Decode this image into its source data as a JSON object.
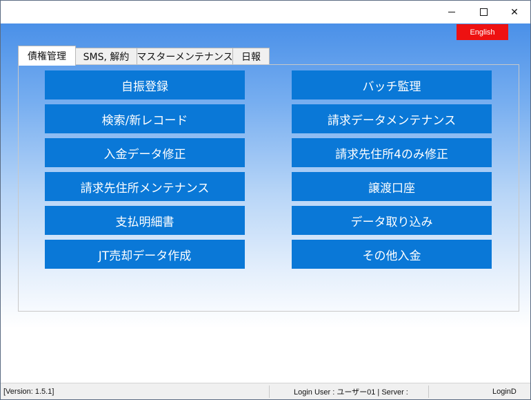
{
  "window": {
    "controls": {
      "minimize_icon": "minimize-icon",
      "maximize_icon": "maximize-icon",
      "close_icon": "close-icon",
      "close_glyph": "✕"
    }
  },
  "language_button": {
    "label": "English",
    "color": "#ee1111"
  },
  "tabs": [
    {
      "label": "債権管理",
      "active": true
    },
    {
      "label": "SMS, 解約",
      "active": false
    },
    {
      "label": "マスターメンテナンス",
      "active": false
    },
    {
      "label": "日報",
      "active": false
    }
  ],
  "buttons": {
    "left": [
      "自振登録",
      "検索/新レコード",
      "入金データ修正",
      "請求先住所メンテナンス",
      "支払明細書",
      "JT売却データ作成"
    ],
    "right": [
      "バッチ監理",
      "請求データメンテナンス",
      "請求先住所4のみ修正",
      "譲渡口座",
      "データ取り込み",
      "その他入金"
    ],
    "color": "#0a78d7"
  },
  "status_bar": {
    "version": "[Version: 1.5.1]",
    "login": "Login User : ユーザー01 | Server :",
    "right": "LoginD"
  }
}
